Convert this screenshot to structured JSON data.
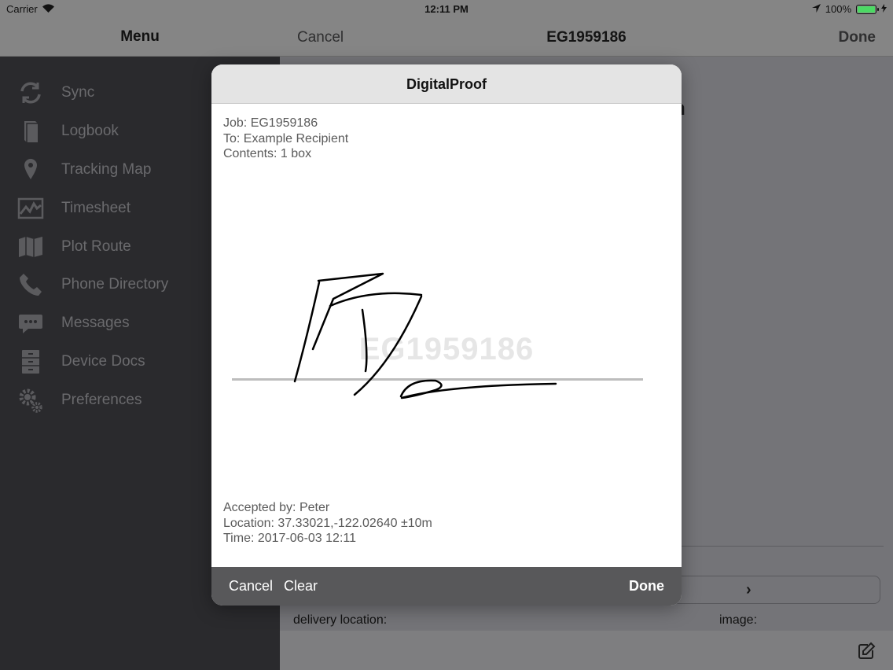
{
  "status_bar": {
    "carrier": "Carrier",
    "time": "12:11 PM",
    "battery": "100%"
  },
  "sidebar": {
    "title": "Menu",
    "items": [
      {
        "label": "Sync",
        "icon": "sync-icon"
      },
      {
        "label": "Logbook",
        "icon": "book-icon"
      },
      {
        "label": "Tracking Map",
        "icon": "map-pin-icon"
      },
      {
        "label": "Timesheet",
        "icon": "chart-line-icon"
      },
      {
        "label": "Plot Route",
        "icon": "folded-map-icon"
      },
      {
        "label": "Phone Directory",
        "icon": "phone-icon"
      },
      {
        "label": "Messages",
        "icon": "chat-bubble-icon"
      },
      {
        "label": "Device Docs",
        "icon": "file-cabinet-icon"
      },
      {
        "label": "Preferences",
        "icon": "gears-icon"
      }
    ]
  },
  "nav": {
    "cancel_label": "Cancel",
    "title": "EG1959186",
    "done_label": "Done"
  },
  "background_form": {
    "heading_fragment": "n",
    "next_symbol": "›",
    "delivery_label": "delivery location:",
    "image_label": "image:"
  },
  "modal": {
    "title": "DigitalProof",
    "job_line": "Job: EG1959186",
    "to_line": "To: Example Recipient",
    "contents_line": "Contents: 1 box",
    "watermark": "EG1959186",
    "accepted_line": "Accepted by: Peter",
    "location_line": "Location: 37.33021,-122.02640 ±10m",
    "time_line": "Time: 2017-06-03 12:11",
    "cancel_label": "Cancel",
    "clear_label": "Clear",
    "done_label": "Done"
  },
  "colors": {
    "battery": "#4cd964",
    "modal_toolbar": "#58585a",
    "sidebar_bg": "#2a2a2d"
  }
}
